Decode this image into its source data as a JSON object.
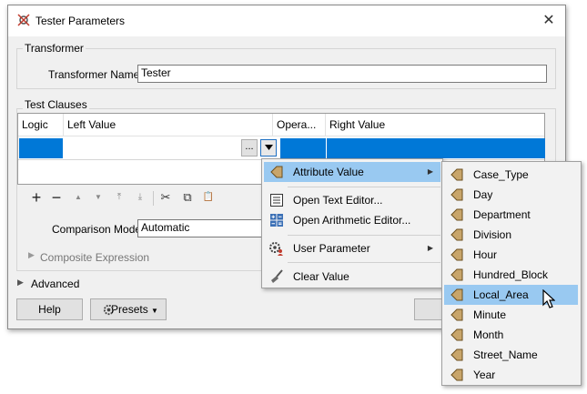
{
  "window": {
    "title": "Tester Parameters",
    "close_glyph": "✕"
  },
  "transformer": {
    "group_label": "Transformer",
    "name_label": "Transformer Name:",
    "name_value": "Tester"
  },
  "test_clauses": {
    "group_label": "Test Clauses",
    "columns": [
      "Logic",
      "Left Value",
      "Opera...",
      "Right Value"
    ],
    "ellipsis": "...",
    "toolbar": [
      "+",
      "−",
      "▲",
      "▼",
      "⤒",
      "⤓",
      "✂",
      "⧉",
      "📋"
    ],
    "comparison_mode_label": "Comparison Mode:",
    "comparison_mode_value": "Automatic",
    "composite_label": "Composite Expression"
  },
  "advanced_label": "Advanced",
  "buttons": {
    "help": "Help",
    "presets": "Presets"
  },
  "context_menu": {
    "items": [
      {
        "label": "Attribute Value",
        "icon": "attribute-arrow-icon",
        "submenu": true,
        "highlighted": true
      },
      {
        "label": "Open Text Editor...",
        "icon": "text-editor-icon"
      },
      {
        "label": "Open Arithmetic Editor...",
        "icon": "arithmetic-editor-icon"
      },
      {
        "label": "User Parameter",
        "icon": "user-parameter-icon",
        "submenu": true
      },
      {
        "label": "Clear Value",
        "icon": "broom-icon"
      }
    ]
  },
  "attribute_submenu": {
    "items": [
      "Case_Type",
      "Day",
      "Department",
      "Division",
      "Hour",
      "Hundred_Block",
      "Local_Area",
      "Minute",
      "Month",
      "Street_Name",
      "Year"
    ],
    "highlighted": "Local_Area"
  },
  "colors": {
    "selection": "#0078d7",
    "menu_highlight": "#99c9f1",
    "attr_icon": "#c8a56a"
  }
}
